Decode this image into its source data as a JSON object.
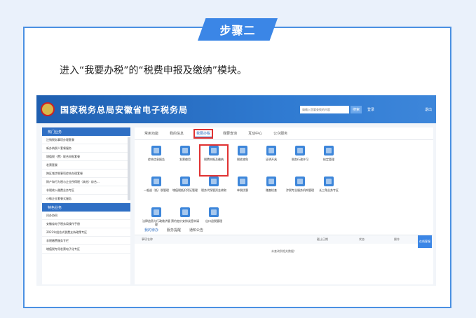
{
  "step_badge": "步骤二",
  "instruction": "进入“我要办税”的“税费申报及缴纳”模块。",
  "topbar": {
    "site_title": "国家税务总局安徽省电子税务局",
    "search_placeholder": "请输入您要查找的内容",
    "search_button": "搜索",
    "login": "登录",
    "exit": "退出"
  },
  "sidebar": {
    "section1_title": "热门业务",
    "section1_items": [
      "注销税务事项办理套餐",
      "新办纳税人套餐服务",
      "增值税（费）联合申报套餐",
      "发票套餐",
      "跨区域涉税事项综合办理套餐",
      "财产和行为税与企业所得税（其他）综合...",
      "非税收入缴费业务专区",
      "小微企业套餐式服务"
    ],
    "section2_title": "特色业务",
    "section2_items": [
      "问办协同",
      "安徽省电子税务局操作手册",
      "2022年组合式税费支持政策专区",
      "非税缴费服务专栏",
      "增值税专用发票电子化专区"
    ]
  },
  "main": {
    "tabs": [
      "常用功能",
      "我的信息",
      "我要办税",
      "我要查询",
      "互动中心",
      "公众服务"
    ],
    "tiles": [
      "综合信息报告",
      "发票使用",
      "税费申报及缴纳",
      "税收减免",
      "证明开具",
      "税务行政许可",
      "核定管理",
      "",
      "一般退（抵）税管理",
      "增值税抵扣凭证管理",
      "税务代保管资金收取",
      "单税优惠",
      "稽查检查",
      "涉税专业服务机构管理",
      "长三角业务专区",
      "",
      "法律追责与行政救济管理",
      "预约定价安排谈签申请",
      "出口退税管理",
      "",
      "",
      "",
      "",
      ""
    ],
    "lower_tabs": [
      "我的待办",
      "服务提醒",
      "通知公告"
    ],
    "table_headers": [
      "事项名称",
      "截止日期",
      "状态",
      "操作"
    ],
    "empty_text": "未查询到相关数据！",
    "float_button": "在线客服"
  }
}
